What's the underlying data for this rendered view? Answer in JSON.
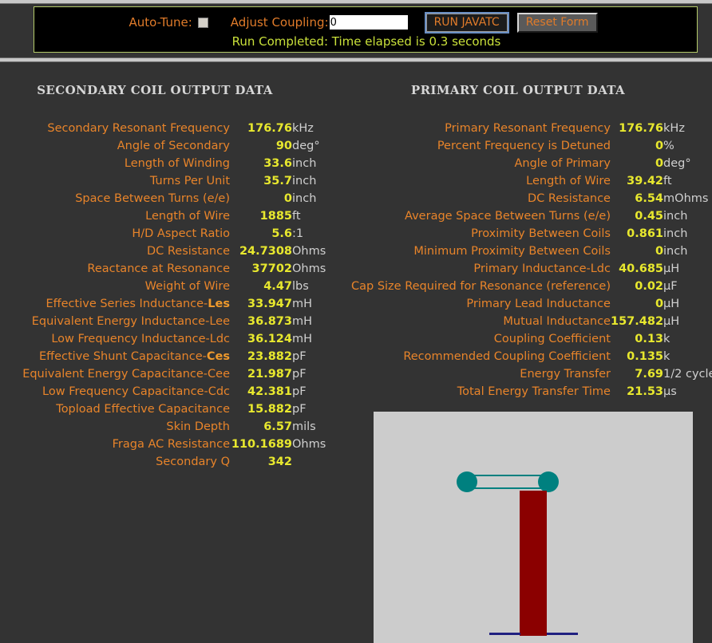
{
  "toolbar": {
    "auto_tune_label": "Auto-Tune:",
    "auto_tune_checked": false,
    "adjust_coupling_label": "Adjust Coupling:",
    "adjust_coupling_value": "0",
    "adjust_coupling_placeholder": "",
    "run_button": "RUN JAVATC",
    "reset_button": "Reset Form",
    "status": "Run Completed: Time elapsed is 0.3 seconds",
    "status_color": "#c9e03a",
    "border_color": "#b5cc6a"
  },
  "secondary": {
    "title": "SECONDARY COIL OUTPUT DATA",
    "rows": [
      {
        "label": "Secondary Resonant Frequency",
        "value": "176.76",
        "unit": "kHz"
      },
      {
        "label": "Angle of Secondary",
        "value": "90",
        "unit": "deg°"
      },
      {
        "label": "Length of Winding",
        "value": "33.6",
        "unit": "inch"
      },
      {
        "label": "Turns Per Unit",
        "value": "35.7",
        "unit": "inch"
      },
      {
        "label": "Space Between Turns (e/e)",
        "value": "0",
        "unit": "inch"
      },
      {
        "label": "Length of Wire",
        "value": "1885",
        "unit": "ft"
      },
      {
        "label": "H/D Aspect Ratio",
        "value": "5.6",
        "unit": ":1"
      },
      {
        "label": "DC Resistance",
        "value": "24.7308",
        "unit": "Ohms"
      },
      {
        "label": "Reactance at Resonance",
        "value": "37702",
        "unit": "Ohms"
      },
      {
        "label": "Weight of Wire",
        "value": "4.47",
        "unit": "lbs"
      },
      {
        "label": "Effective Series Inductance-",
        "emph": "Les",
        "value": "33.947",
        "unit": "mH"
      },
      {
        "label": "Equivalent Energy Inductance-Lee",
        "value": "36.873",
        "unit": "mH"
      },
      {
        "label": "Low Frequency Inductance-Ldc",
        "value": "36.124",
        "unit": "mH"
      },
      {
        "label": "Effective Shunt Capacitance-",
        "emph": "Ces",
        "value": "23.882",
        "unit": "pF"
      },
      {
        "label": "Equivalent Energy Capacitance-Cee",
        "value": "21.987",
        "unit": "pF"
      },
      {
        "label": "Low Frequency Capacitance-Cdc",
        "value": "42.381",
        "unit": "pF"
      },
      {
        "label": "Topload Effective Capacitance",
        "value": "15.882",
        "unit": "pF"
      },
      {
        "label": "Skin Depth",
        "value": "6.57",
        "unit": "mils"
      },
      {
        "label": "Fraga AC Resistance",
        "value": "110.1689",
        "unit": "Ohms"
      },
      {
        "label": "Secondary Q",
        "value": "342",
        "unit": ""
      }
    ]
  },
  "primary": {
    "title": "PRIMARY COIL OUTPUT DATA",
    "rows": [
      {
        "label": "Primary Resonant Frequency",
        "value": "176.76",
        "unit": "kHz"
      },
      {
        "label": "Percent Frequency is Detuned",
        "value": "0",
        "unit": "%"
      },
      {
        "label": "Angle of Primary",
        "value": "0",
        "unit": "deg°"
      },
      {
        "label": "Length of Wire",
        "value": "39.42",
        "unit": "ft"
      },
      {
        "label": "DC Resistance",
        "value": "6.54",
        "unit": "mOhms"
      },
      {
        "label": "Average Space Between Turns (e/e)",
        "value": "0.45",
        "unit": "inch"
      },
      {
        "label": "Proximity Between Coils",
        "value": "0.861",
        "unit": "inch"
      },
      {
        "label": "Minimum Proximity Between Coils",
        "value": "0",
        "unit": "inch"
      },
      {
        "label": "Primary Inductance-Ldc",
        "value": "40.685",
        "unit": "µH"
      },
      {
        "label": "Cap Size Required for Resonance (reference)",
        "value": "0.02",
        "unit": "µF"
      },
      {
        "label": "Primary Lead Inductance",
        "value": "0",
        "unit": "µH"
      },
      {
        "label": "Mutual Inductance",
        "value": "157.482",
        "unit": "µH"
      },
      {
        "label": "Coupling Coefficient",
        "value": "0.13",
        "unit": "k"
      },
      {
        "label": "Recommended Coupling Coefficient",
        "value": "0.135",
        "unit": "k"
      },
      {
        "label": "Energy Transfer",
        "value": "7.69",
        "unit": "1/2 cycle"
      },
      {
        "label": "Total Energy Transfer Time",
        "value": "21.53",
        "unit": "µs"
      }
    ]
  },
  "diagram": {
    "background": "#cccccc",
    "topload_color": "#00807f",
    "secondary_color": "#8b0000",
    "primary_color": "#202080"
  }
}
